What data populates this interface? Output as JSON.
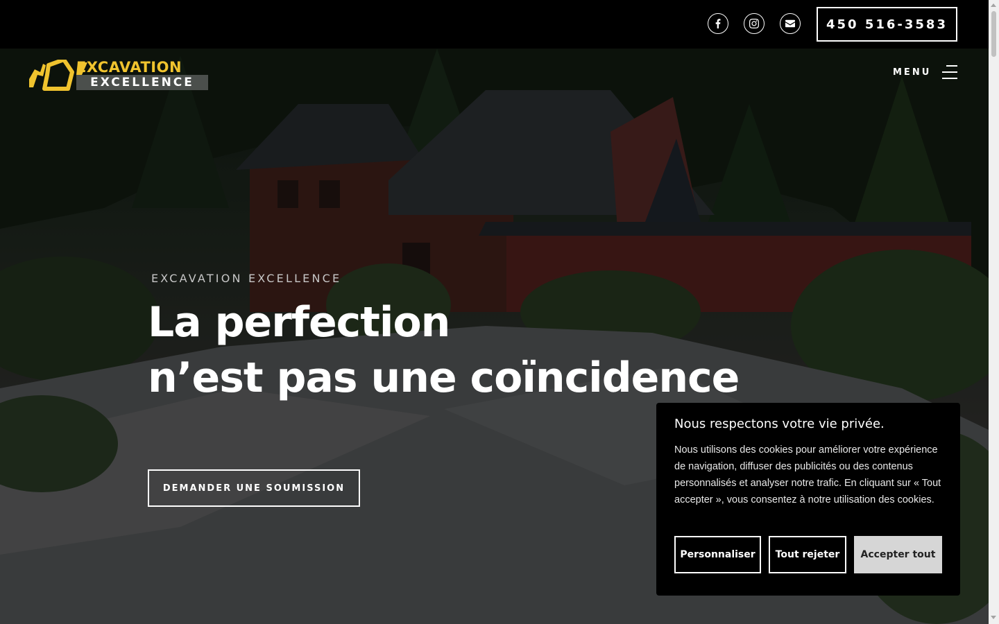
{
  "topbar": {
    "social": [
      {
        "name": "facebook-icon",
        "glyph": "f"
      },
      {
        "name": "instagram-icon",
        "glyph": "instagram"
      },
      {
        "name": "envelope-icon",
        "glyph": "mail"
      }
    ],
    "phone": "450 516-3583"
  },
  "brand": {
    "logo_word_1": "EXCAVATION",
    "logo_word_2": "EXCELLENCE",
    "accent": "#f0c32e",
    "plate": "#4b4f4c"
  },
  "nav": {
    "menu_label": "MENU"
  },
  "hero": {
    "eyebrow": "EXCAVATION EXCELLENCE",
    "headline_line1": "La perfection",
    "headline_line2": "n’est pas une coïncidence",
    "cta": "DEMANDER UNE SOUMISSION"
  },
  "cookie": {
    "title": "Nous respectons votre vie privée.",
    "body": "Nous utilisons des cookies pour améliorer votre expérience de navigation, diffuser des publicités ou des contenus personnalisés et analyser notre trafic. En cliquant sur « Tout accepter », vous consentez à notre utilisation des cookies.",
    "customize": "Personnaliser",
    "reject": "Tout rejeter",
    "accept": "Accepter tout"
  }
}
